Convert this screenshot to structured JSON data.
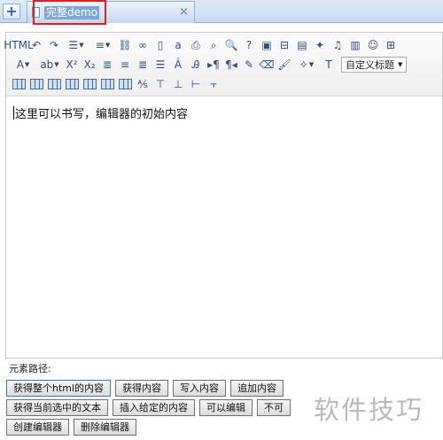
{
  "tabs": {
    "add_label": "+",
    "active_tab": {
      "title": "完整demo",
      "close": "×"
    }
  },
  "toolbar": {
    "row1": [
      {
        "name": "source-html-button",
        "label": "HTML"
      },
      {
        "name": "undo-button",
        "label": "↶"
      },
      {
        "name": "redo-button",
        "label": "↷"
      },
      {
        "name": "unordered-list-button",
        "label": "☰",
        "dropdown": true
      },
      {
        "name": "ordered-list-button",
        "label": "≡",
        "dropdown": true
      },
      {
        "name": "unlink-button",
        "label": "⛓"
      },
      {
        "name": "link-button",
        "label": "∞"
      },
      {
        "name": "new-page-button",
        "label": "▯"
      },
      {
        "name": "anchor-button",
        "label": "a"
      },
      {
        "name": "print-button",
        "label": "⎙"
      },
      {
        "name": "find-button",
        "label": "⌕"
      },
      {
        "name": "preview-button",
        "label": "🔍"
      },
      {
        "name": "help-button",
        "label": "?"
      },
      {
        "name": "image-button",
        "label": "▣"
      },
      {
        "name": "insert-frame-button",
        "label": "⊟"
      },
      {
        "name": "media-button",
        "label": "▤"
      },
      {
        "name": "spark-button",
        "label": "✦"
      },
      {
        "name": "music-button",
        "label": "♫"
      },
      {
        "name": "chart-button",
        "label": "▥"
      },
      {
        "name": "emoticon-button",
        "label": "☺"
      },
      {
        "name": "page-break-button",
        "label": "⊞"
      }
    ],
    "row2": [
      {
        "name": "font-color-button",
        "label": "A",
        "dropdown": true
      },
      {
        "name": "back-color-button",
        "label": "ab",
        "dropdown": true
      },
      {
        "name": "superscript-button",
        "label": "X²"
      },
      {
        "name": "subscript-button",
        "label": "X₂"
      },
      {
        "name": "align-left-button",
        "label": "≣"
      },
      {
        "name": "align-center-button",
        "label": "≡"
      },
      {
        "name": "align-right-button",
        "label": "≣"
      },
      {
        "name": "justify-button",
        "label": "☰"
      },
      {
        "name": "font-size-button",
        "label": "Ȧ"
      },
      {
        "name": "case-button",
        "label": "Ꭿ"
      },
      {
        "name": "ltr-button",
        "label": "▸¶"
      },
      {
        "name": "rtl-button",
        "label": "¶◂"
      },
      {
        "name": "format-match-button",
        "label": "✎"
      },
      {
        "name": "eraser-button",
        "label": "⌫"
      },
      {
        "name": "brush-button",
        "label": "🖌"
      },
      {
        "name": "auto-format-button",
        "label": "✧",
        "dropdown": true
      },
      {
        "name": "paste-plain-button",
        "label": "T"
      }
    ],
    "paragraph_combo": {
      "value": "自定义标题"
    },
    "row3": [
      {
        "name": "insert-table-button"
      },
      {
        "name": "delete-table-button"
      },
      {
        "name": "insert-row-before-button"
      },
      {
        "name": "insert-row-after-button"
      },
      {
        "name": "delete-row-button"
      },
      {
        "name": "insert-col-button"
      },
      {
        "name": "delete-col-button"
      },
      {
        "name": "merge-cells-button",
        "label": "⅍"
      },
      {
        "name": "merge-right-button",
        "label": "⊤"
      },
      {
        "name": "merge-down-button",
        "label": "⊥"
      },
      {
        "name": "split-cells-button",
        "label": "⊢"
      },
      {
        "name": "split-rows-button",
        "label": "⫟"
      }
    ]
  },
  "editor": {
    "content": "这里可以书写，编辑器的初始内容"
  },
  "path_bar": {
    "label": "元素路径:"
  },
  "buttons": {
    "row1": [
      "获得整个html的内容",
      "获得内容",
      "写入内容",
      "追加内容"
    ],
    "row2": [
      "获得当前选中的文本",
      "插入给定的内容",
      "可以编辑",
      "不可"
    ],
    "row3": [
      "创建编辑器",
      "删除编辑器"
    ]
  },
  "watermark": "软件技巧"
}
